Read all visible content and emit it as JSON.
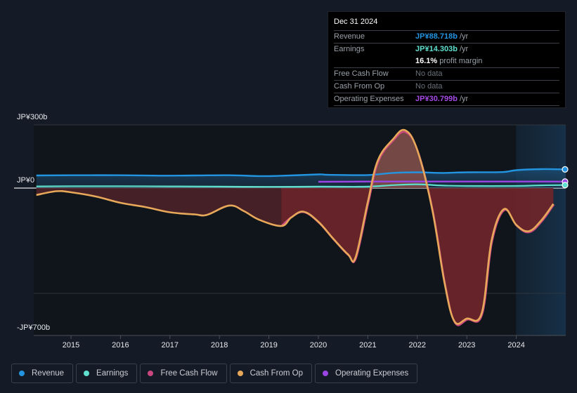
{
  "tooltip": {
    "date": "Dec 31 2024",
    "rows": [
      {
        "label": "Revenue",
        "value": "JP¥88.718b",
        "suffix": " /yr",
        "color": "#2394e0"
      },
      {
        "label": "Earnings",
        "value": "JP¥14.303b",
        "suffix": " /yr",
        "color": "#5fe0cf"
      },
      {
        "label": "",
        "value": "16.1%",
        "suffix": " profit margin",
        "color": "#ffffff"
      },
      {
        "label": "Free Cash Flow",
        "value": "No data",
        "suffix": "",
        "color": "#6b7079"
      },
      {
        "label": "Cash From Op",
        "value": "No data",
        "suffix": "",
        "color": "#6b7079"
      },
      {
        "label": "Operating Expenses",
        "value": "JP¥30.799b",
        "suffix": " /yr",
        "color": "#a54ae6"
      }
    ]
  },
  "legend": [
    {
      "label": "Revenue",
      "color": "#2394e0"
    },
    {
      "label": "Earnings",
      "color": "#5fe0cf"
    },
    {
      "label": "Free Cash Flow",
      "color": "#c9467e"
    },
    {
      "label": "Cash From Op",
      "color": "#e8a85a"
    },
    {
      "label": "Operating Expenses",
      "color": "#9b45e4"
    }
  ],
  "chart_data": {
    "type": "area",
    "title": "",
    "xlabel": "",
    "ylabel": "",
    "currency": "JPY",
    "y_tick_labels": [
      "JP¥300b",
      "JP¥0",
      "-JP¥700b"
    ],
    "y_gridlines": [
      300,
      0,
      -500,
      -700
    ],
    "ylim": [
      -700,
      300
    ],
    "xlim": [
      2014.3,
      2025.0
    ],
    "x_tick_labels": [
      "2015",
      "2016",
      "2017",
      "2018",
      "2019",
      "2020",
      "2021",
      "2022",
      "2023",
      "2024"
    ],
    "x_ticks": [
      2015,
      2016,
      2017,
      2018,
      2019,
      2020,
      2021,
      2022,
      2023,
      2024
    ],
    "highlight_range": [
      2024.0,
      2025.0
    ],
    "grid": true,
    "legend_position": "bottom-left",
    "series": [
      {
        "name": "Revenue",
        "color": "#2394e0",
        "x": [
          2014.3,
          2015.0,
          2016.0,
          2016.8,
          2017.5,
          2018.2,
          2018.8,
          2019.2,
          2020.0,
          2020.2,
          2021.0,
          2021.5,
          2022.0,
          2022.5,
          2023.0,
          2023.7,
          2024.0,
          2024.5,
          2025.0
        ],
        "values": [
          60,
          61,
          61,
          59,
          60,
          61,
          57,
          58,
          65,
          63,
          62,
          72,
          75,
          72,
          75,
          76,
          85,
          90,
          88.7
        ]
      },
      {
        "name": "Earnings",
        "color": "#5fe0cf",
        "x": [
          2014.3,
          2015.0,
          2016.0,
          2017.0,
          2018.0,
          2019.0,
          2020.0,
          2021.0,
          2021.5,
          2022.0,
          2022.5,
          2023.0,
          2024.0,
          2024.5,
          2025.0
        ],
        "values": [
          8,
          9,
          9,
          8,
          7,
          6,
          7,
          7,
          14,
          18,
          12,
          10,
          10,
          13,
          14.3
        ]
      },
      {
        "name": "Operating Expenses",
        "color": "#9b45e4",
        "x": [
          2020.0,
          2021.0,
          2022.0,
          2023.0,
          2024.0,
          2025.0
        ],
        "values": [
          30,
          31,
          31,
          31,
          31,
          30.8
        ]
      },
      {
        "name": "Free Cash Flow",
        "color": "#c9467e",
        "x": [
          2019.25,
          2019.45,
          2019.7,
          2020.0,
          2020.3,
          2020.6,
          2020.75,
          2021.0,
          2021.2,
          2021.5,
          2021.75,
          2022.0,
          2022.3,
          2022.55,
          2022.75,
          2023.0,
          2023.3,
          2023.5,
          2023.75,
          2024.0,
          2024.25,
          2024.5,
          2024.75
        ],
        "values": [
          -173,
          -132,
          -110,
          -160,
          -240,
          -315,
          -328,
          -65,
          130,
          230,
          270,
          180,
          -100,
          -450,
          -635,
          -620,
          -595,
          -250,
          -100,
          -175,
          -205,
          -155,
          -73
        ]
      },
      {
        "name": "Cash From Op",
        "color": "#e8a85a",
        "x": [
          2014.3,
          2014.7,
          2015.0,
          2015.5,
          2016.0,
          2016.5,
          2017.0,
          2017.5,
          2017.75,
          2018.2,
          2018.5,
          2018.8,
          2019.25,
          2019.45,
          2019.7,
          2020.0,
          2020.3,
          2020.6,
          2020.75,
          2021.0,
          2021.2,
          2021.5,
          2021.75,
          2022.0,
          2022.3,
          2022.55,
          2022.75,
          2023.0,
          2023.3,
          2023.5,
          2023.75,
          2024.0,
          2024.25,
          2024.5,
          2024.75
        ],
        "values": [
          -33,
          -15,
          -20,
          -40,
          -70,
          -90,
          -115,
          -125,
          -127,
          -83,
          -110,
          -150,
          -180,
          -140,
          -112,
          -160,
          -240,
          -315,
          -330,
          -65,
          130,
          230,
          275,
          180,
          -100,
          -450,
          -633,
          -620,
          -595,
          -250,
          -100,
          -175,
          -205,
          -155,
          -75
        ]
      }
    ]
  }
}
